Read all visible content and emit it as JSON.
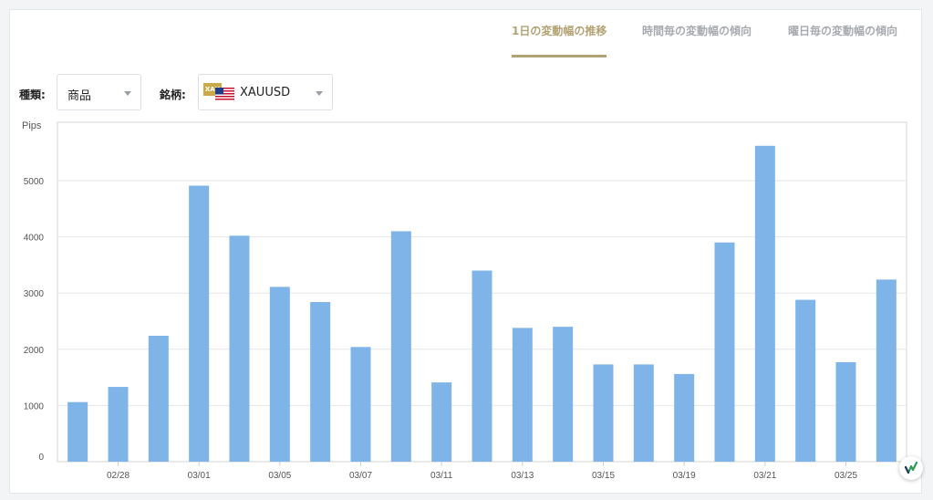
{
  "tabs": [
    {
      "label": "1日の変動幅の推移",
      "active": true
    },
    {
      "label": "時間毎の変動幅の傾向",
      "active": false
    },
    {
      "label": "曜日毎の変動幅の傾向",
      "active": false
    }
  ],
  "filters": {
    "category_label": "種類:",
    "category_value": "商品",
    "symbol_label": "銘柄:",
    "symbol_value": "XAUUSD",
    "symbol_icon": "XAU"
  },
  "colors": {
    "accent": "#b3a273",
    "bar": "#7eb4e8",
    "grid": "#e6e6e6"
  },
  "chart_data": {
    "type": "bar",
    "ylabel": "Pips",
    "ylim": [
      0,
      6000
    ],
    "yticks": [
      0,
      1000,
      2000,
      3000,
      4000,
      5000
    ],
    "grid": true,
    "x_tick_labels": [
      "02/28",
      "03/01",
      "03/05",
      "03/07",
      "03/11",
      "03/13",
      "03/15",
      "03/19",
      "03/21",
      "03/25"
    ],
    "x_tick_positions": [
      1.5,
      3.5,
      5.5,
      7.5,
      9.5,
      11.5,
      13.5,
      15.5,
      17.5,
      19.5
    ],
    "values": [
      1060,
      1330,
      2240,
      4910,
      4020,
      3110,
      2840,
      2040,
      4100,
      1410,
      3400,
      2380,
      2400,
      1730,
      1730,
      1560,
      3900,
      5620,
      2880,
      1770,
      3240
    ]
  }
}
